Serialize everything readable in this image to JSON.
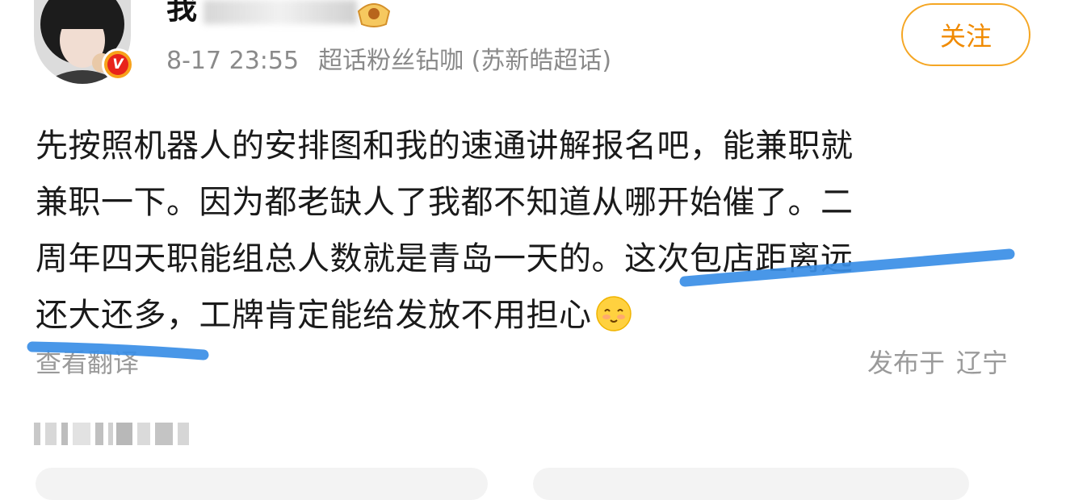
{
  "post": {
    "username": "我",
    "timestamp": "8-17 23:55",
    "source": "超话粉丝钻咖 (苏新皓超话)",
    "follow_label": "关注",
    "verified_mark": "V",
    "text_lines": [
      "先按照机器人的安排图和我的速通讲解报名吧，能兼职就",
      "兼职一下。因为都老缺人了我都不知道从哪开始催了。二",
      "周年四天职能组总人数就是青岛一天的。这次包店距离远",
      "还大还多，工牌肯定能给发放不用担心"
    ],
    "translate_label": "查看翻译",
    "location_prefix": "发布于",
    "location": "辽宁"
  },
  "icons": {
    "avatar": "avatar",
    "verified": "verified-badge-icon",
    "fan_badge": "fan-badge-icon",
    "emoji": "smile-emoji-icon"
  },
  "colors": {
    "follow_border": "#f5a623",
    "follow_text": "#f08a00",
    "meta_text": "#8a8a8a",
    "highlight_stroke": "#3a8ee6"
  }
}
